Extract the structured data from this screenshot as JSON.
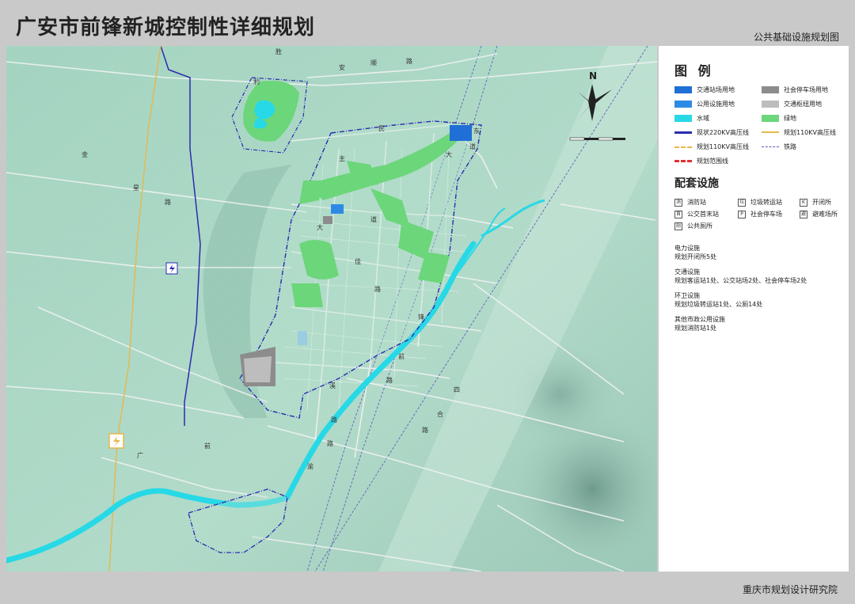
{
  "header": {
    "title": "广安市前锋新城控制性详细规划",
    "subtitle": "公共基础设施规划图"
  },
  "footer": {
    "organization": "重庆市规划设计研究院"
  },
  "legend": {
    "title": "图  例",
    "items": [
      {
        "label": "交通站场用地",
        "color": "#1f6fd6",
        "kind": "fill"
      },
      {
        "label": "社会停车场用地",
        "color": "#8c8c8c",
        "kind": "fill"
      },
      {
        "label": "公用设施用地",
        "color": "#2f8ae6",
        "kind": "fill"
      },
      {
        "label": "交通枢纽用地",
        "color": "#bdbdbd",
        "kind": "fill"
      },
      {
        "label": "水域",
        "color": "#27d9e6",
        "kind": "fill"
      },
      {
        "label": "绿地",
        "color": "#6cd67a",
        "kind": "fill"
      },
      {
        "label": "现状220KV高压线",
        "color": "#2b2bb0",
        "kind": "line"
      },
      {
        "label": "规划110KV高压线",
        "color": "#e6b84c",
        "kind": "line"
      },
      {
        "label": "规划110KV高压线",
        "color": "#e6b84c",
        "kind": "dashline"
      },
      {
        "label": "铁路",
        "color": "#5a5ab0",
        "kind": "rail"
      },
      {
        "label": "规划范围线",
        "color": "#e03030",
        "kind": "boundary"
      }
    ]
  },
  "facilities": {
    "title": "配套设施",
    "items": [
      {
        "icon": "消",
        "label": "消防站"
      },
      {
        "icon": "垃",
        "label": "垃圾转运站"
      },
      {
        "icon": "K",
        "label": "开闭所"
      },
      {
        "icon": "首",
        "label": "公交首末站"
      },
      {
        "icon": "P",
        "label": "社会停车场"
      },
      {
        "icon": "避",
        "label": "避难场所"
      },
      {
        "icon": "厕",
        "label": "公共厕所"
      }
    ]
  },
  "notes": [
    {
      "heading": "电力设施",
      "body": "规划开闭所5处"
    },
    {
      "heading": "交通设施",
      "body": "规划客运站1处、公交站场2处、社会停车场2处"
    },
    {
      "heading": "环卫设施",
      "body": "规划垃圾转运站1处、公厕14处"
    },
    {
      "heading": "其他市政公用设施",
      "body": "规划消防站1处"
    }
  ],
  "map": {
    "north_label": "N",
    "road_labels": [
      "胜",
      "利",
      "安",
      "顺",
      "路",
      "金",
      "星",
      "路",
      "民",
      "主",
      "大",
      "道",
      "佳",
      "路",
      "前",
      "锋",
      "路",
      "溪",
      "路",
      "广",
      "前",
      "渝",
      "路",
      "四",
      "合",
      "路",
      "东",
      "大",
      "道"
    ]
  }
}
